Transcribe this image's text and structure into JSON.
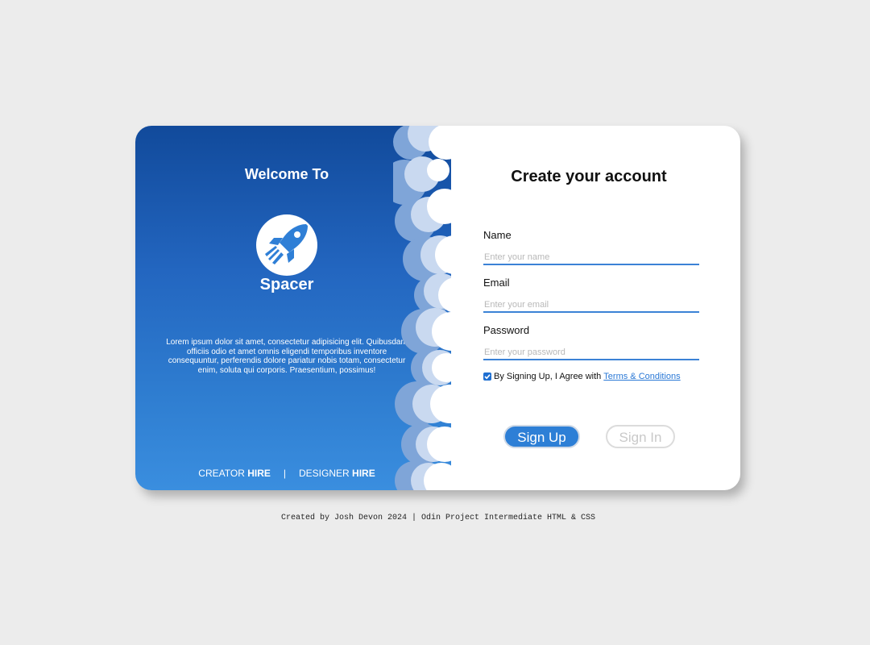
{
  "colors": {
    "page_bg": "#ececec",
    "panel_top": "#114a9b",
    "panel_bottom": "#3a8edf",
    "accent": "#2d7fd6",
    "link": "#2a78d6"
  },
  "left": {
    "welcome": "Welcome To",
    "logo_icon": "rocket-icon",
    "brand": "Spacer",
    "description": "Lorem ipsum dolor sit amet, consectetur adipisicing elit. Quibusdam officiis odio et amet omnis eligendi temporibus inventore consequuntur, perferendis dolore pariatur nobis totam, consectetur enim, soluta qui corporis. Praesentium, possimus!",
    "footer": {
      "creator_prefix": "CREATOR",
      "creator_bold": "HIRE",
      "separator": "|",
      "designer_prefix": "DESIGNER",
      "designer_bold": "HIRE"
    }
  },
  "form": {
    "title": "Create your account",
    "name_label": "Name",
    "name_placeholder": "Enter your name",
    "name_value": "",
    "email_label": "Email",
    "email_placeholder": "Enter your email",
    "email_value": "",
    "password_label": "Password",
    "password_placeholder": "Enter your password",
    "password_value": "",
    "agree_text": "By Signing Up, I Agree with",
    "terms_link": "Terms & Conditions",
    "agree_checked": true,
    "signup_label": "Sign Up",
    "signin_label": "Sign In"
  },
  "credit": "Created by Josh Devon 2024 | Odin Project Intermediate HTML & CSS"
}
